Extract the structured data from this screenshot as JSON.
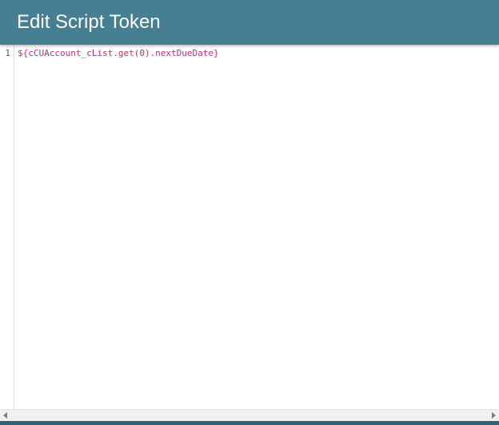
{
  "dialog": {
    "title": "Edit Script Token"
  },
  "editor": {
    "lines": [
      {
        "number": "1",
        "code": "${cCUAccount_cList.get(0).nextDueDate}"
      }
    ]
  },
  "colors": {
    "header": "#467f92",
    "code_text": "#c0306e",
    "footer": "#2f6273"
  },
  "icons": {
    "scroll_left": "chevron-left-icon",
    "scroll_right": "chevron-right-icon"
  }
}
